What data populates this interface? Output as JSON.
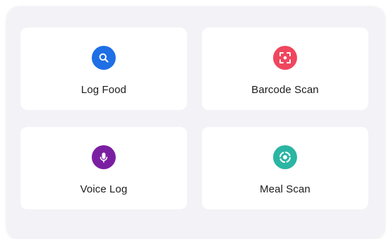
{
  "actions": [
    {
      "label": "Log Food",
      "icon": "search-icon",
      "color": "#1f6fe5"
    },
    {
      "label": "Barcode Scan",
      "icon": "barcode-scan-icon",
      "color": "#f0465e"
    },
    {
      "label": "Voice Log",
      "icon": "microphone-icon",
      "color": "#7b1fa2"
    },
    {
      "label": "Meal Scan",
      "icon": "meal-scan-icon",
      "color": "#2bb5a3"
    }
  ]
}
